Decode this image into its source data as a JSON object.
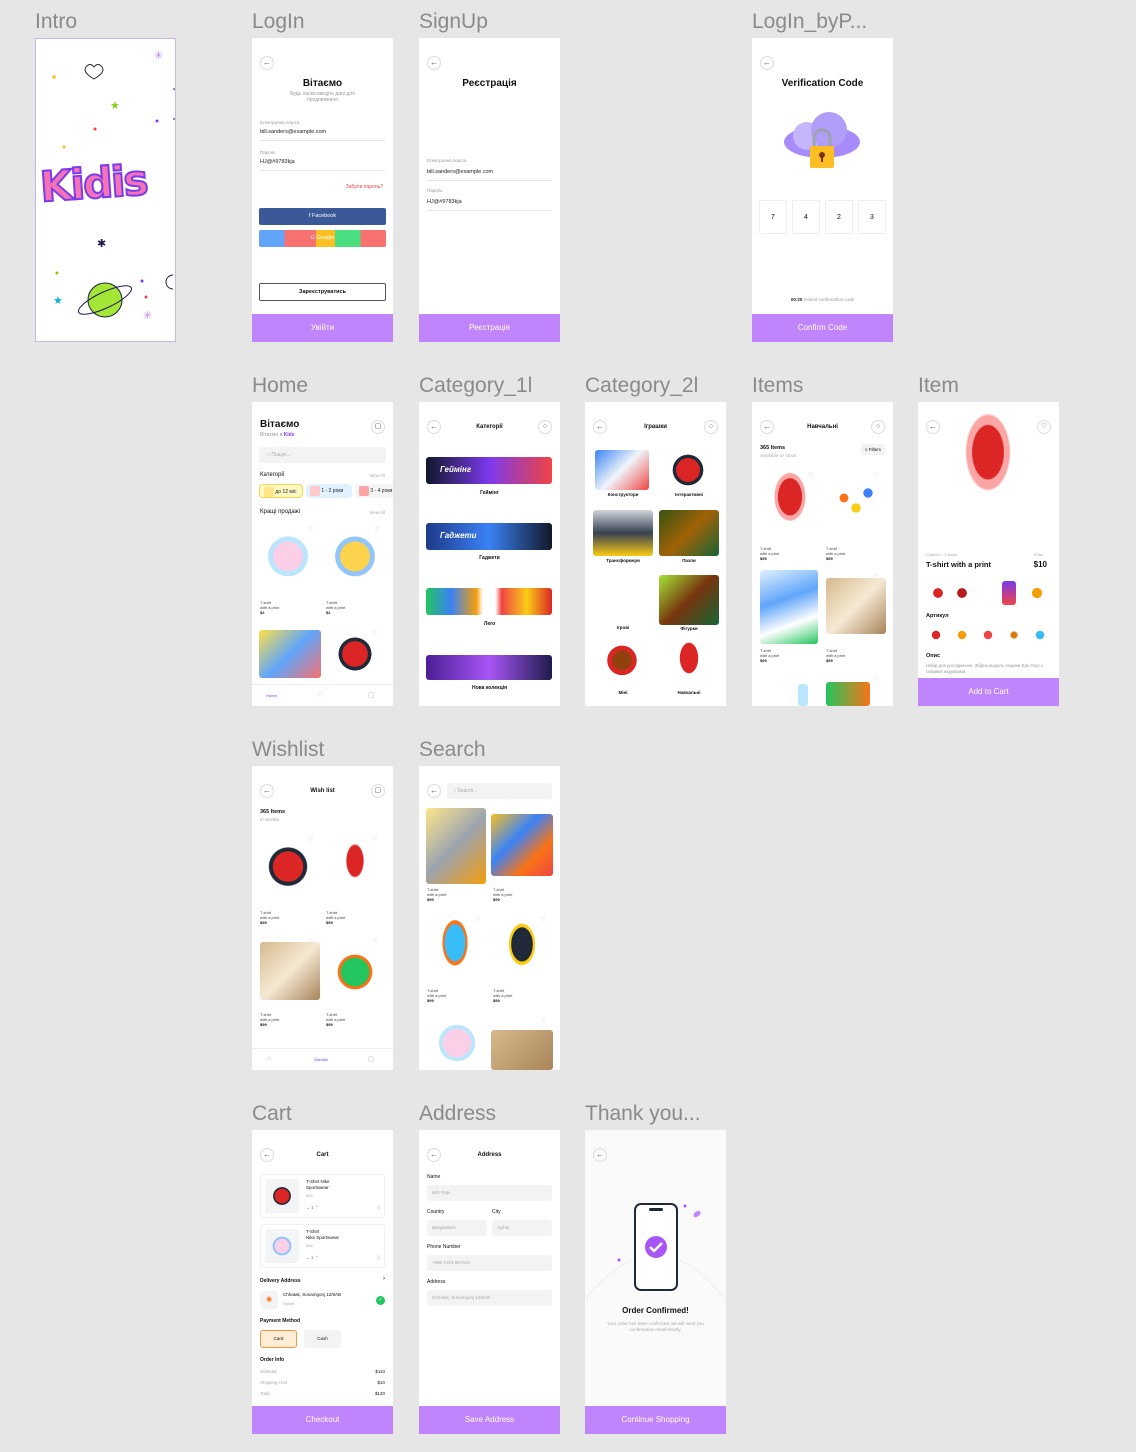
{
  "frames": {
    "intro": {
      "label": "Intro",
      "logo": "Kidis"
    },
    "login": {
      "label": "LogIn",
      "title": "Вітаємо",
      "subtitle": "Будь ласка введіть дані для продовження",
      "email_label": "Електронна пошта",
      "email_value": "bill.sanders@example.com",
      "password_label": "Пароль",
      "password_value": "HJ@#9783kja",
      "forgot": "Забули пароль?",
      "facebook": "Facebook",
      "google": "Google",
      "register": "Зареєструватись",
      "submit": "Увійти"
    },
    "signup": {
      "label": "SignUp",
      "title": "Реєстрація",
      "email_label": "Електронна пошта",
      "email_value": "bill.sanders@example.com",
      "password_label": "Пароль",
      "password_value": "HJ@#9783kja",
      "submit": "Реєстрація"
    },
    "verify": {
      "label": "LogIn_byP...",
      "title": "Verification Code",
      "digits": [
        "7",
        "4",
        "2",
        "3"
      ],
      "timer": "00:20",
      "resend": "resend confirmation code",
      "submit": "Confirm Code"
    },
    "home": {
      "label": "Home",
      "title": "Вітаємо",
      "subtitle": "Вітаємо в",
      "brand": "Kids",
      "search": "Пошук...",
      "categories": "Категорії",
      "view_all": "View All",
      "chips": [
        "до 12 міс",
        "1 - 2 роки",
        "3 - 4 роки"
      ],
      "bestsellers": "Кращі продажі",
      "view_all2": "View All",
      "products": [
        {
          "name": "T-shirt",
          "sub": "with a print",
          "price": "$2"
        },
        {
          "name": "T-shirt",
          "sub": "with a print",
          "price": "$2"
        }
      ],
      "nav_home": "Home"
    },
    "category1": {
      "label": "Category_1l",
      "title": "Категорії",
      "items": [
        "Геймінг",
        "Гаджети",
        "Лего",
        "Нова колекція"
      ],
      "banners": [
        "Геймінг",
        "Гаджети"
      ]
    },
    "category2": {
      "label": "Category_2l",
      "title": "Іграшки",
      "items": [
        "Конструктори",
        "Інтерактивні",
        "Трансформери",
        "Пазли",
        "Ігрові",
        "Фігурки",
        "Міні",
        "Навчальні"
      ]
    },
    "items": {
      "label": "Items",
      "title": "Навчальні",
      "count": "365 Items",
      "stock": "Available on stock",
      "filters": "Filters",
      "products": [
        {
          "name": "T-shirt",
          "sub": "with a print",
          "price": "$99"
        },
        {
          "name": "T-shirt",
          "sub": "with a print",
          "price": "$99"
        },
        {
          "name": "T-shirt",
          "sub": "with a print",
          "price": "$99"
        },
        {
          "name": "T-shirt",
          "sub": "with a print",
          "price": "$99"
        }
      ]
    },
    "item": {
      "label": "Item",
      "breadcrumb": "Clothes > T-shirts",
      "price_label": "Price",
      "name": "T-shirt with a print",
      "price": "$10",
      "article": "Артикул",
      "desc_title": "Опис",
      "desc": "Набір для дослідження. Збірна модель людини Edu-Toys з співавки надувками",
      "submit": "Add to Cart"
    },
    "wishlist": {
      "label": "Wishlist",
      "title": "Wish list",
      "count": "365 Items",
      "sub": "In wishlist",
      "products": [
        {
          "name": "T-shirt",
          "sub": "with a print",
          "price": "$99"
        },
        {
          "name": "T-shirt",
          "sub": "with a print",
          "price": "$99"
        },
        {
          "name": "T-shirt",
          "sub": "with a print",
          "price": "$99"
        },
        {
          "name": "T-shirt",
          "sub": "with a print",
          "price": "$99"
        }
      ],
      "nav_wishlist": "Wishlist"
    },
    "search": {
      "label": "Search",
      "placeholder": "Search...",
      "products": [
        {
          "name": "T-shirt",
          "sub": "with a print",
          "price": "$99"
        },
        {
          "name": "T-shirt",
          "sub": "with a print",
          "price": "$99"
        },
        {
          "name": "T-shirt",
          "sub": "with a print",
          "price": "$99"
        },
        {
          "name": "T-shirt",
          "sub": "with a print",
          "price": "$99"
        }
      ]
    },
    "cart": {
      "label": "Cart",
      "title": "Cart",
      "items": [
        {
          "name": "T-Shirt Nike",
          "name2": "Sportswear",
          "price": "$45",
          "qty": "1"
        },
        {
          "name": "T-Shirt",
          "name2": "Nike Sportswear",
          "price": "$45",
          "qty": "1"
        }
      ],
      "delivery": "Delivery Address",
      "address": "Chhatak, Sunamgonj 12/8AB",
      "city": "Sylhet",
      "payment": "Payment Method",
      "card": "Card",
      "cash": "Cash",
      "order_info": "Order Info",
      "subtotal_label": "Subtotal",
      "subtotal": "$110",
      "shipping_label": "Shipping cost",
      "shipping": "$10",
      "total_label": "Total",
      "total": "$120",
      "submit": "Checkout"
    },
    "address": {
      "label": "Address",
      "title": "Address",
      "name_label": "Name",
      "name_value": "Mrh Raju",
      "country_label": "Country",
      "country_value": "Bangladesh",
      "city_label": "City",
      "city_value": "Sylhet",
      "phone_label": "Phone Number",
      "phone_value": "+880 1453-987533",
      "address_label": "Address",
      "address_value": "Chhatak, Sunamgonj 12/8AB",
      "submit": "Save Address"
    },
    "thanks": {
      "label": "Thank you...",
      "title": "Order Confirmed!",
      "text": "Your order has been confirmed, we will send you confirmation email shortly.",
      "submit": "Continue Shopping"
    }
  },
  "colors": {
    "accent": "#c084fc",
    "primary_text": "#111111",
    "facebook": "#3b5998",
    "forgot": "#ef4444",
    "success": "#22c55e"
  }
}
